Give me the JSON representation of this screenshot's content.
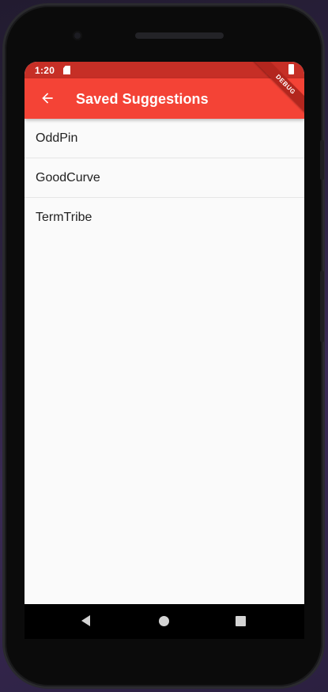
{
  "status_bar": {
    "time": "1:20",
    "icons": [
      "sd-card-icon",
      "wifi-icon",
      "battery-icon"
    ]
  },
  "app_bar": {
    "title": "Saved Suggestions",
    "back_icon": "arrow-left-icon",
    "color": "#f44336"
  },
  "debug_banner": {
    "label": "DEBUG"
  },
  "saved_suggestions": [
    {
      "label": "OddPin"
    },
    {
      "label": "GoodCurve"
    },
    {
      "label": "TermTribe"
    }
  ],
  "nav_bar": {
    "icons": [
      "nav-back-icon",
      "nav-home-icon",
      "nav-recents-icon"
    ]
  },
  "colors": {
    "status_bar": "#c62f26",
    "app_bar": "#f44336",
    "background": "#fafafa"
  }
}
